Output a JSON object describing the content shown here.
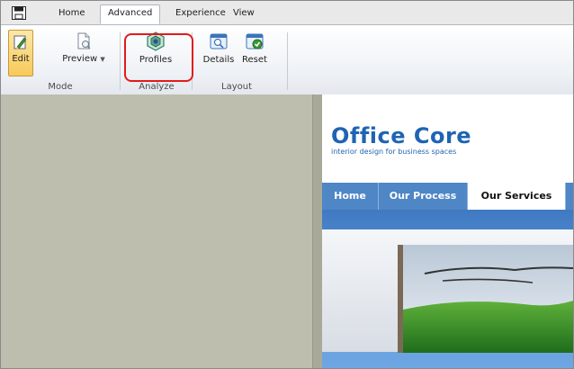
{
  "ribbon_tabs": [
    {
      "label": "Home",
      "active": false
    },
    {
      "label": "Advanced",
      "active": true
    },
    {
      "label": "Experience",
      "active": false
    },
    {
      "label": "View",
      "active": false
    }
  ],
  "ribbon": {
    "buttons": {
      "edit": {
        "label": "Edit",
        "icon": "edit-icon",
        "pressed": true
      },
      "preview": {
        "label": "Preview",
        "icon": "preview-icon"
      },
      "profiles": {
        "label": "Profiles",
        "icon": "profiles-icon"
      },
      "details": {
        "label": "Details",
        "icon": "details-icon"
      },
      "reset": {
        "label": "Reset",
        "icon": "reset-icon"
      }
    },
    "groups": {
      "mode": "Mode",
      "analyze": "Analyze",
      "layout": "Layout"
    }
  },
  "site": {
    "logo_title": "Office Core",
    "logo_subtitle": "interior design for business spaces",
    "nav": [
      {
        "label": "Home",
        "active": false
      },
      {
        "label": "Our Process",
        "active": false
      },
      {
        "label": "Our Services",
        "active": true
      }
    ]
  },
  "colors": {
    "accent": "#1f64b3",
    "nav_bar": "#4f86c6",
    "highlight_box": "#e21b1b",
    "workspace": "#bebeae"
  }
}
